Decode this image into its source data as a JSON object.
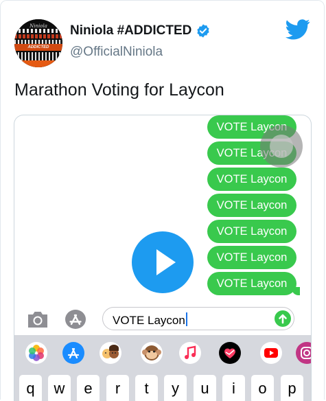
{
  "tweet": {
    "display_name": "Niniola #ADDICTED",
    "handle": "@OfficialNiniola",
    "text": "Marathon Voting for Laycon",
    "avatar": {
      "script_text": "Niniola",
      "banner_text": "ADDICTED"
    }
  },
  "messages": [
    "VOTE Laycon",
    "VOTE Laycon",
    "VOTE Laycon",
    "VOTE Laycon",
    "VOTE Laycon",
    "VOTE Laycon",
    "VOTE Laycon"
  ],
  "composer": {
    "input_value": "VOTE Laycon"
  },
  "app_tray": [
    {
      "icon": "photos-icon",
      "color": "#ffffff"
    },
    {
      "icon": "app-store-icon",
      "color": "#1a8cff"
    },
    {
      "icon": "memoji-icon",
      "color": "#ffffff"
    },
    {
      "icon": "monkey-animoji-icon",
      "color": "#ffffff"
    },
    {
      "icon": "music-icon",
      "color": "#ffffff"
    },
    {
      "icon": "digital-touch-icon",
      "color": "#000000"
    },
    {
      "icon": "youtube-icon",
      "color": "#ffffff"
    },
    {
      "icon": "instagram-icon",
      "color": "#c13584"
    }
  ],
  "keyboard_row": [
    "q",
    "w",
    "e",
    "r",
    "t",
    "y",
    "u",
    "i",
    "o",
    "p"
  ],
  "colors": {
    "bubble": "#39c94d",
    "twitter_blue": "#1d9bf0",
    "verified": "#1d9bf0"
  }
}
